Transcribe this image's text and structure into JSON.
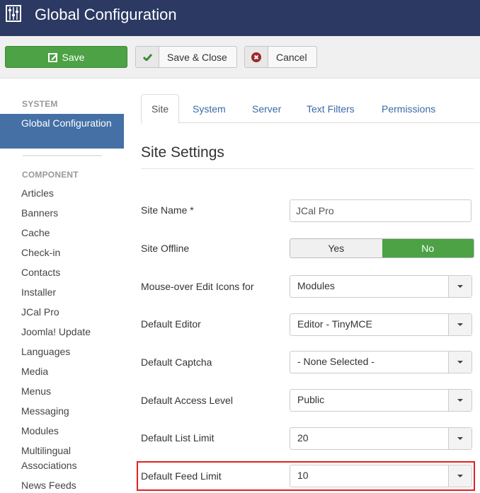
{
  "header": {
    "title": "Global Configuration",
    "icon": "sliders-icon"
  },
  "toolbar": {
    "save_label": "Save",
    "save_close_label": "Save & Close",
    "cancel_label": "Cancel"
  },
  "sidebar": {
    "system_heading": "SYSTEM",
    "active_item": "Global Configuration",
    "component_heading": "COMPONENT",
    "items": [
      "Articles",
      "Banners",
      "Cache",
      "Check-in",
      "Contacts",
      "Installer",
      "JCal Pro",
      "Joomla! Update",
      "Languages",
      "Media",
      "Menus",
      "Messaging",
      "Modules",
      "Multilingual Associations",
      "News Feeds"
    ]
  },
  "tabs": [
    {
      "label": "Site",
      "active": true
    },
    {
      "label": "System",
      "active": false
    },
    {
      "label": "Server",
      "active": false
    },
    {
      "label": "Text Filters",
      "active": false
    },
    {
      "label": "Permissions",
      "active": false
    }
  ],
  "section": {
    "title": "Site Settings"
  },
  "fields": {
    "site_name": {
      "label": "Site Name *",
      "value": "JCal Pro"
    },
    "site_offline": {
      "label": "Site Offline",
      "yes": "Yes",
      "no": "No",
      "selected": "No"
    },
    "mouseover": {
      "label": "Mouse-over Edit Icons for",
      "value": "Modules"
    },
    "editor": {
      "label": "Default Editor",
      "value": "Editor - TinyMCE"
    },
    "captcha": {
      "label": "Default Captcha",
      "value": "- None Selected -"
    },
    "access": {
      "label": "Default Access Level",
      "value": "Public"
    },
    "list_limit": {
      "label": "Default List Limit",
      "value": "20"
    },
    "feed_limit": {
      "label": "Default Feed Limit",
      "value": "10"
    }
  },
  "colors": {
    "header_bg": "#2b3963",
    "success": "#4ca245",
    "sidebar_active": "#4470a5",
    "highlight": "#e02020"
  }
}
